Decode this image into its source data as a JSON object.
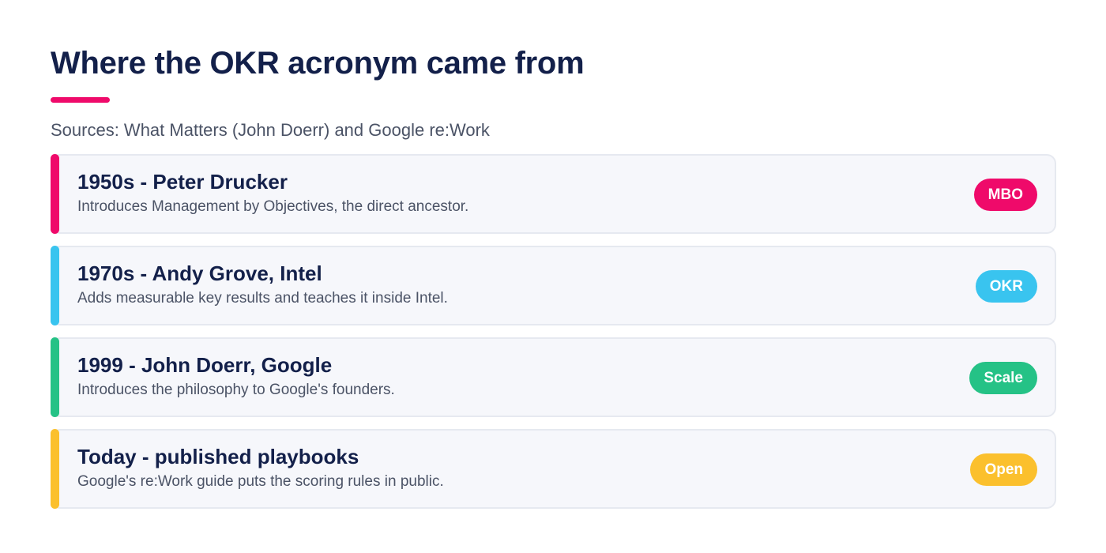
{
  "header": {
    "title": "Where the OKR acronym came from",
    "subtitle": "Sources: What Matters (John Doerr) and Google re:Work",
    "accent_color": "#ef0a6a"
  },
  "timeline": {
    "items": [
      {
        "heading": "1950s - Peter Drucker",
        "description": "Introduces Management by Objectives, the direct ancestor.",
        "badge": "MBO",
        "color": "#ef0a6a"
      },
      {
        "heading": "1970s - Andy Grove, Intel",
        "description": "Adds measurable key results and teaches it inside Intel.",
        "badge": "OKR",
        "color": "#39c4ef"
      },
      {
        "heading": "1999 - John Doerr, Google",
        "description": "Introduces the philosophy to Google's founders.",
        "badge": "Scale",
        "color": "#25c286"
      },
      {
        "heading": "Today - published playbooks",
        "description": "Google's re:Work guide puts the scoring rules in public.",
        "badge": "Open",
        "color": "#fbc02d"
      }
    ]
  }
}
